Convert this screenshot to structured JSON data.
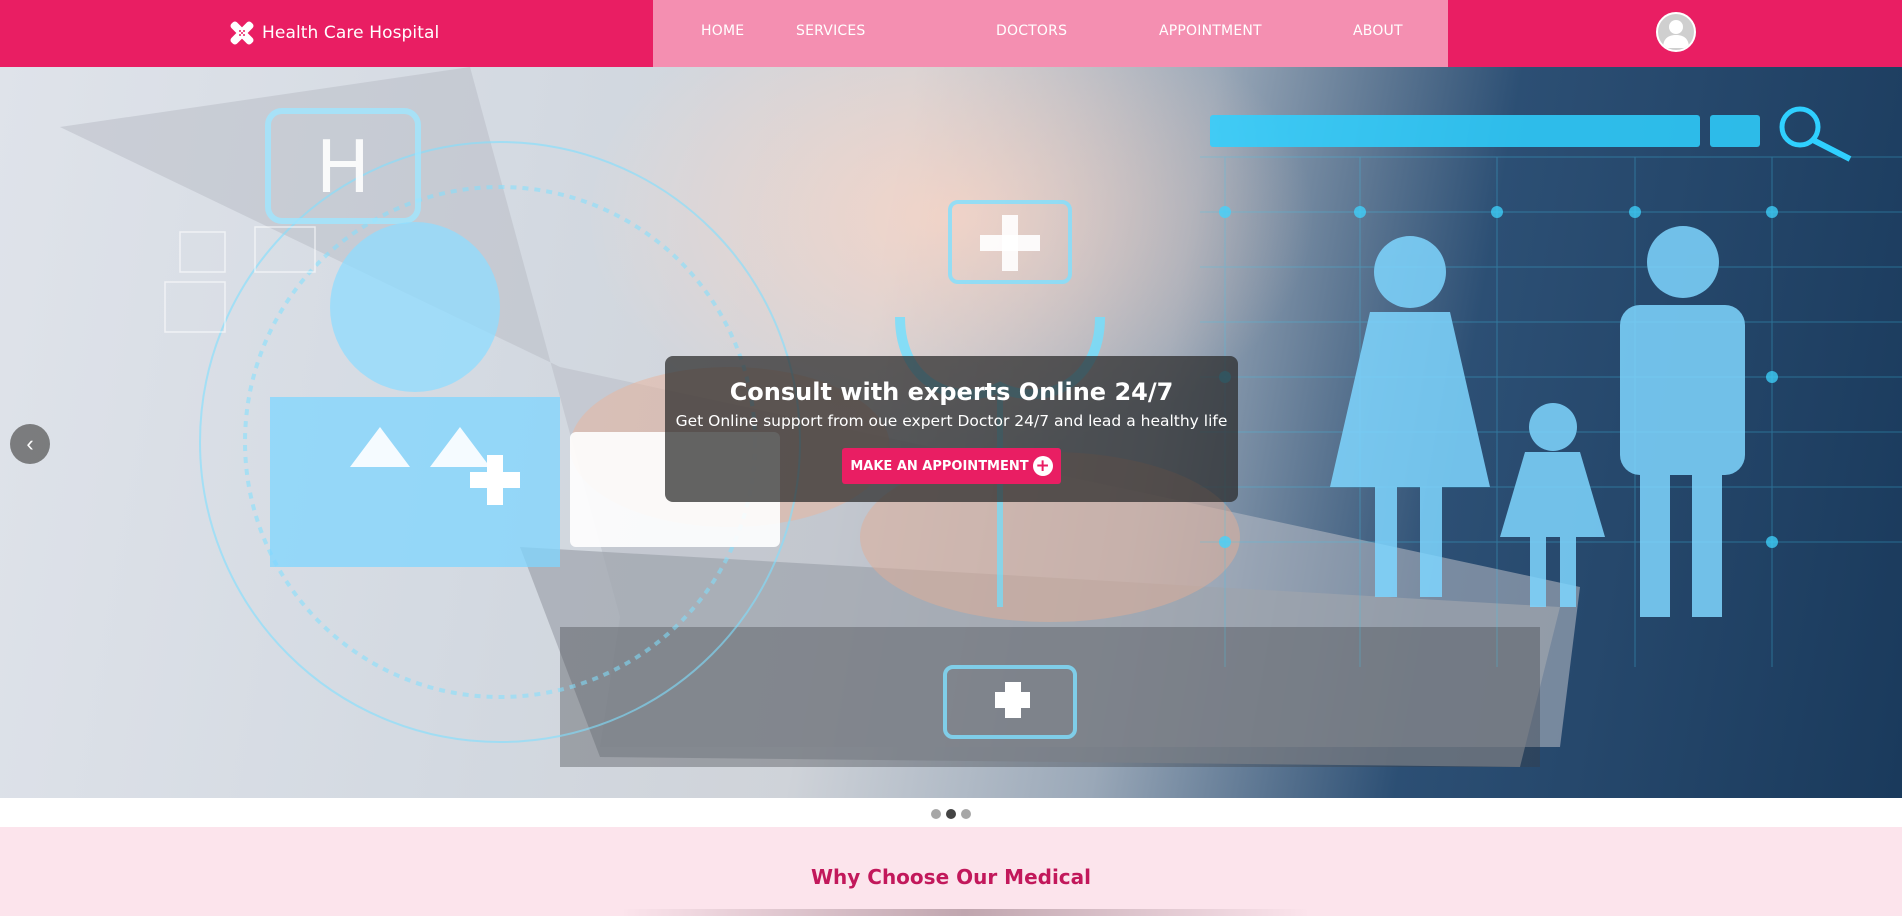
{
  "navbar": {
    "brand": "Health Care Hospital",
    "links": [
      "HOME",
      "SERVICES",
      "DOCTORS",
      "APPOINTMENT",
      "ABOUT"
    ]
  },
  "hero": {
    "title": "Consult with experts Online 24/7",
    "subtitle": "Get Online support from oue expert Doctor 24/7 and lead a healthy life",
    "cta_label": "MAKE AN APPOINTMENT",
    "slide_count": 3,
    "active_slide": 2
  },
  "why": {
    "title": "Why Choose Our Medical"
  },
  "icons": {
    "brand": "medical-cross-logo-icon",
    "avatar": "user-icon",
    "cta": "plus-circle-icon",
    "prev": "chevron-left-icon"
  },
  "colors": {
    "primary": "#e91e63",
    "nav_menu_bg": "#f48fb1",
    "section_bg": "#fce4ec",
    "section_title": "#c2185b",
    "caption_bg": "rgba(40,40,40,0.72)"
  }
}
